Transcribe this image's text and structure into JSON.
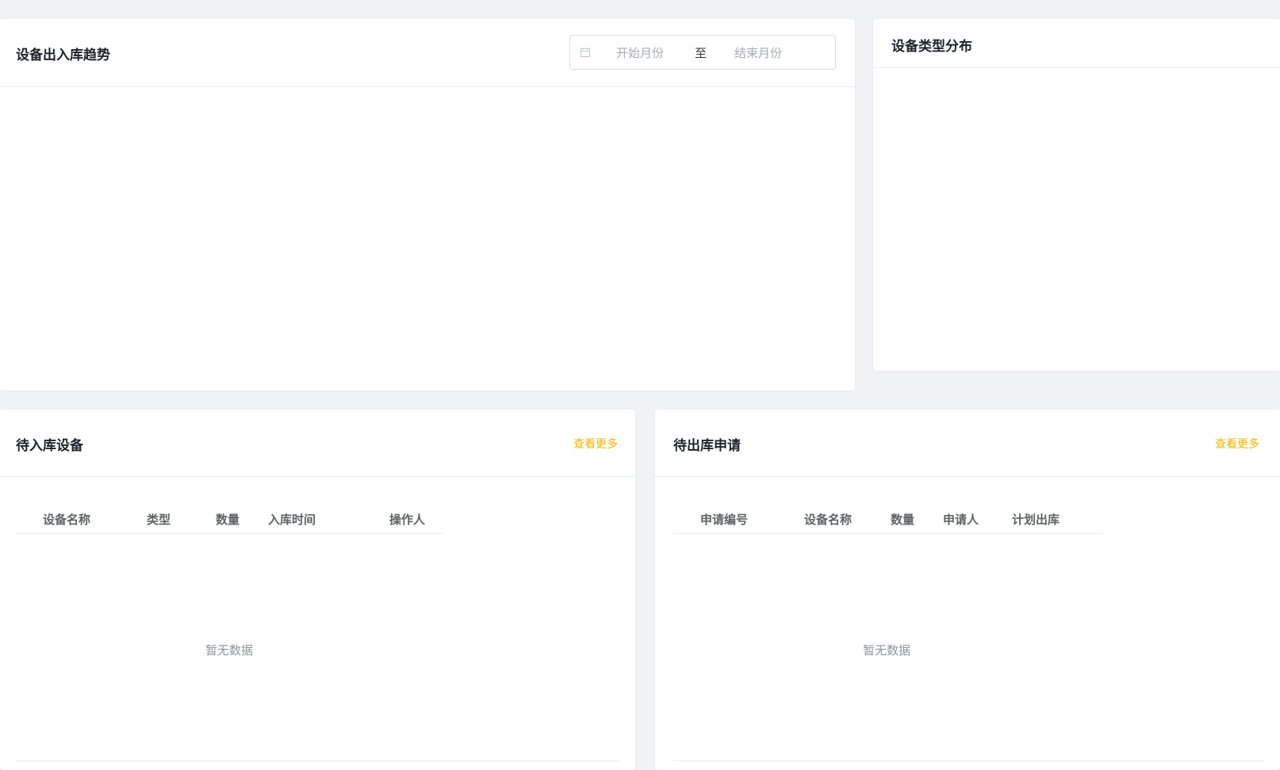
{
  "trend_panel": {
    "title": "设备出入库趋势",
    "date_range": {
      "start_placeholder": "开始月份",
      "separator": "至",
      "end_placeholder": "结束月份"
    }
  },
  "type_panel": {
    "title": "设备类型分布"
  },
  "inbound_panel": {
    "title": "待入库设备",
    "more_label": "查看更多",
    "columns": [
      "设备名称",
      "类型",
      "数量",
      "入库时间",
      "操作人"
    ],
    "empty_text": "暂无数据"
  },
  "outbound_panel": {
    "title": "待出库申请",
    "more_label": "查看更多",
    "columns": [
      "申请编号",
      "设备名称",
      "数量",
      "申请人",
      "计划出库"
    ],
    "empty_text": "暂无数据"
  },
  "colors": {
    "accent": "#f0b400",
    "background": "#f0f2f5"
  },
  "icons": {
    "date_picker": "calendar-icon"
  }
}
